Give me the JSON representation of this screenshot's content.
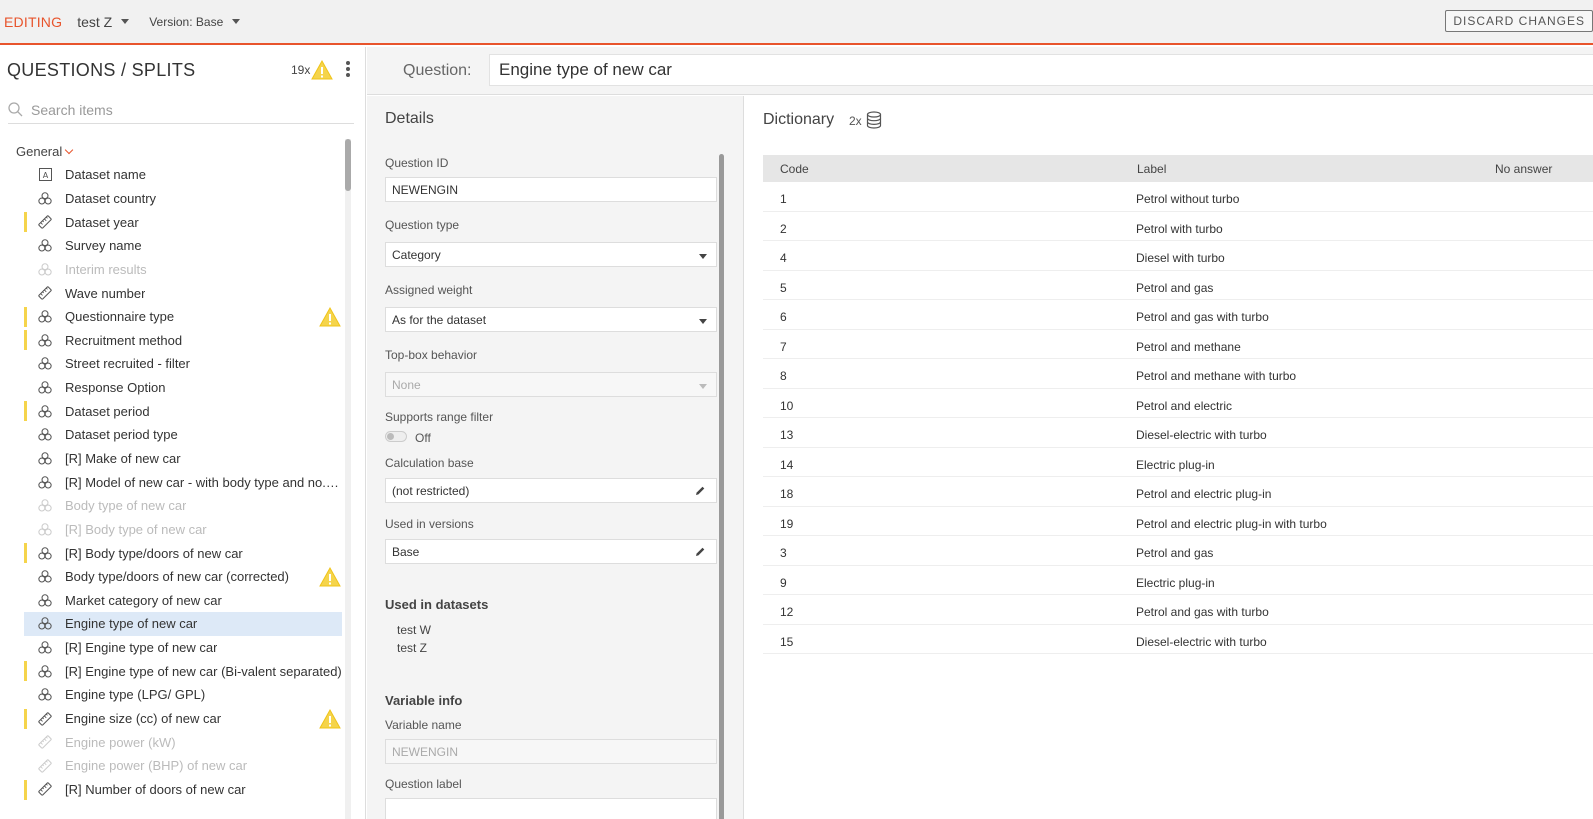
{
  "topbar": {
    "mode": "EDITING",
    "dataset": "test Z",
    "version": "Version: Base",
    "discard_label": "DISCARD CHANGES"
  },
  "left": {
    "title": "QUESTIONS / SPLITS",
    "warning_count": "19x",
    "search_placeholder": "Search items",
    "group": "General",
    "items": [
      {
        "label": "Dataset name",
        "icon": "text-icon",
        "dim": false,
        "bar": false,
        "warn": false,
        "sel": false
      },
      {
        "label": "Dataset country",
        "icon": "category-icon",
        "dim": false,
        "bar": false,
        "warn": false,
        "sel": false
      },
      {
        "label": "Dataset year",
        "icon": "ruler-icon",
        "dim": false,
        "bar": true,
        "warn": false,
        "sel": false
      },
      {
        "label": "Survey name",
        "icon": "category-icon",
        "dim": false,
        "bar": false,
        "warn": false,
        "sel": false
      },
      {
        "label": "Interim results",
        "icon": "category-icon",
        "dim": true,
        "bar": false,
        "warn": false,
        "sel": false
      },
      {
        "label": "Wave number",
        "icon": "ruler-icon",
        "dim": false,
        "bar": false,
        "warn": false,
        "sel": false
      },
      {
        "label": "Questionnaire type",
        "icon": "category-icon",
        "dim": false,
        "bar": true,
        "warn": true,
        "sel": false
      },
      {
        "label": "Recruitment method",
        "icon": "category-icon",
        "dim": false,
        "bar": true,
        "warn": false,
        "sel": false
      },
      {
        "label": "Street recruited - filter",
        "icon": "category-icon",
        "dim": false,
        "bar": false,
        "warn": false,
        "sel": false
      },
      {
        "label": "Response Option",
        "icon": "category-icon",
        "dim": false,
        "bar": false,
        "warn": false,
        "sel": false
      },
      {
        "label": "Dataset period",
        "icon": "category-icon",
        "dim": false,
        "bar": true,
        "warn": false,
        "sel": false
      },
      {
        "label": "Dataset period type",
        "icon": "category-icon",
        "dim": false,
        "bar": false,
        "warn": false,
        "sel": false
      },
      {
        "label": "[R] Make of new car",
        "icon": "category-icon",
        "dim": false,
        "bar": false,
        "warn": false,
        "sel": false
      },
      {
        "label": "[R] Model of new car - with body type and no. of ...",
        "icon": "category-icon",
        "dim": false,
        "bar": false,
        "warn": false,
        "sel": false
      },
      {
        "label": "Body type of new car",
        "icon": "category-icon",
        "dim": true,
        "bar": false,
        "warn": false,
        "sel": false
      },
      {
        "label": "[R] Body type of new car",
        "icon": "category-icon",
        "dim": true,
        "bar": false,
        "warn": false,
        "sel": false
      },
      {
        "label": "[R] Body type/doors of new car",
        "icon": "category-icon",
        "dim": false,
        "bar": true,
        "warn": false,
        "sel": false
      },
      {
        "label": "Body type/doors of new car (corrected)",
        "icon": "category-icon",
        "dim": false,
        "bar": false,
        "warn": true,
        "sel": false
      },
      {
        "label": "Market category of new car",
        "icon": "category-icon",
        "dim": false,
        "bar": false,
        "warn": false,
        "sel": false
      },
      {
        "label": "Engine type of new car",
        "icon": "category-icon",
        "dim": false,
        "bar": false,
        "warn": false,
        "sel": true
      },
      {
        "label": "[R] Engine type of new car",
        "icon": "category-icon",
        "dim": false,
        "bar": false,
        "warn": false,
        "sel": false
      },
      {
        "label": "[R] Engine type of new car (Bi-valent separated)",
        "icon": "category-icon",
        "dim": false,
        "bar": true,
        "warn": false,
        "sel": false
      },
      {
        "label": "Engine type (LPG/ GPL)",
        "icon": "category-icon",
        "dim": false,
        "bar": false,
        "warn": false,
        "sel": false
      },
      {
        "label": "Engine size (cc) of new car",
        "icon": "ruler-icon",
        "dim": false,
        "bar": true,
        "warn": true,
        "sel": false
      },
      {
        "label": "Engine power (kW)",
        "icon": "ruler-icon",
        "dim": true,
        "bar": false,
        "warn": false,
        "sel": false
      },
      {
        "label": "Engine power (BHP) of new car",
        "icon": "ruler-icon",
        "dim": true,
        "bar": false,
        "warn": false,
        "sel": false
      },
      {
        "label": "[R] Number of doors of new car",
        "icon": "ruler-icon",
        "dim": false,
        "bar": true,
        "warn": false,
        "sel": false
      }
    ]
  },
  "question": {
    "label": "Question:",
    "value": "Engine type of new car"
  },
  "details": {
    "title": "Details",
    "question_id_label": "Question ID",
    "question_id": "NEWENGIN",
    "question_type_label": "Question type",
    "question_type": "Category",
    "assigned_weight_label": "Assigned weight",
    "assigned_weight": "As for the dataset",
    "topbox_label": "Top-box behavior",
    "topbox": "None",
    "range_filter_label": "Supports range filter",
    "range_filter": "Off",
    "calc_base_label": "Calculation base",
    "calc_base": "(not restricted)",
    "versions_label": "Used in versions",
    "versions": "Base",
    "datasets_label": "Used in datasets",
    "datasets": [
      "test W",
      "test Z"
    ],
    "varinfo_label": "Variable info",
    "varname_label": "Variable name",
    "varname": "NEWENGIN",
    "qlabel_label": "Question label"
  },
  "dictionary": {
    "title": "Dictionary",
    "count": "2x",
    "headers": {
      "code": "Code",
      "label": "Label",
      "noanswer": "No answer"
    },
    "rows": [
      {
        "code": "1",
        "label": "Petrol without turbo"
      },
      {
        "code": "2",
        "label": "Petrol with turbo"
      },
      {
        "code": "4",
        "label": "Diesel with turbo"
      },
      {
        "code": "5",
        "label": "Petrol and gas"
      },
      {
        "code": "6",
        "label": "Petrol and gas with turbo"
      },
      {
        "code": "7",
        "label": "Petrol and methane"
      },
      {
        "code": "8",
        "label": "Petrol and methane with turbo"
      },
      {
        "code": "10",
        "label": "Petrol and electric"
      },
      {
        "code": "13",
        "label": "Diesel-electric with turbo"
      },
      {
        "code": "14",
        "label": "Electric plug-in"
      },
      {
        "code": "18",
        "label": "Petrol and electric plug-in"
      },
      {
        "code": "19",
        "label": "Petrol and electric plug-in with turbo"
      },
      {
        "code": "3",
        "label": "Petrol and gas"
      },
      {
        "code": "9",
        "label": "Electric plug-in"
      },
      {
        "code": "12",
        "label": "Petrol and gas with turbo"
      },
      {
        "code": "15",
        "label": "Diesel-electric with turbo"
      }
    ]
  },
  "colors": {
    "accent": "#e8542c",
    "warning": "#f5d44b",
    "selected": "#dde9f7"
  }
}
